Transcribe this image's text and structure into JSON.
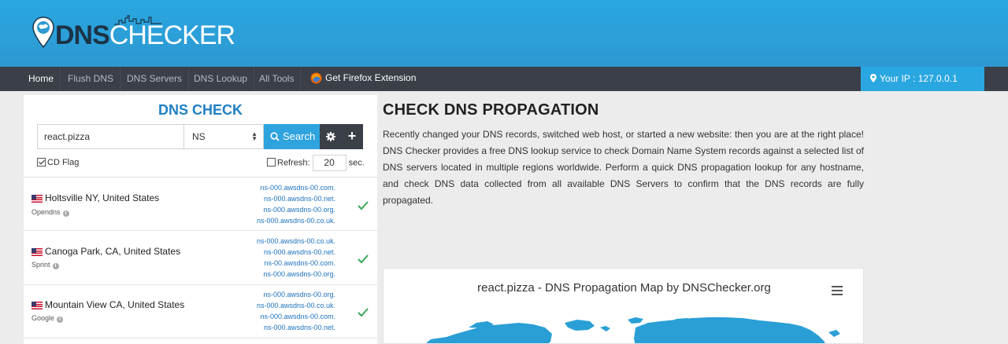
{
  "header": {
    "logo_dns": "DNS",
    "logo_checker": "CHECKER"
  },
  "nav": {
    "items": [
      {
        "label": "Home",
        "active": true
      },
      {
        "label": "Flush DNS"
      },
      {
        "label": "DNS Servers"
      },
      {
        "label": "DNS Lookup"
      },
      {
        "label": "All Tools"
      }
    ],
    "firefox_label": "Get Firefox Extension",
    "your_ip": "Your IP : 127.0.0.1"
  },
  "check": {
    "title": "DNS CHECK",
    "domain_value": "react.pizza",
    "record_type": "NS",
    "search_label": "Search",
    "cd_flag_label": "CD Flag",
    "cd_flag_checked": true,
    "refresh_label": "Refresh:",
    "refresh_value": "20",
    "refresh_unit": "sec."
  },
  "results": [
    {
      "location": "Holtsville NY, United States",
      "isp": "Opendns",
      "ns": [
        "ns-000.awsdns-00.com.",
        "ns-000.awsdns-00.net.",
        "ns-000.awsdns-00.org.",
        "ns-000.awsdns-00.co.uk."
      ],
      "status": "ok"
    },
    {
      "location": "Canoga Park, CA, United States",
      "isp": "Sprint",
      "ns": [
        "ns-000.awsdns-00.co.uk.",
        "ns-000.awsdns-00.net.",
        "ns-00.awsdns-00.com.",
        "ns-000.awsdns-00.org."
      ],
      "status": "ok"
    },
    {
      "location": "Mountain View CA, United States",
      "isp": "Google",
      "ns": [
        "ns-000.awsdns-00.org.",
        "ns-000.awsdns-00.co.uk.",
        "ns-000.awsdns-00.com.",
        "ns-000.awsdns-00.net."
      ],
      "status": "ok"
    }
  ],
  "main": {
    "title": "CHECK DNS PROPAGATION",
    "description": "Recently changed your DNS records, switched web host, or started a new website: then you are at the right place! DNS Checker provides a free DNS lookup service to check Domain Name System records against a selected list of DNS servers located in multiple regions worldwide. Perform a quick DNS propagation lookup for any hostname, and check DNS data collected from all available DNS Servers to confirm that the DNS records are fully propagated.",
    "map_title": "react.pizza - DNS Propagation Map by DNSChecker.org"
  },
  "colors": {
    "header": "#2aa7e0",
    "nav": "#3a3f48",
    "accent": "#1f7fc4",
    "ok": "#3aa757",
    "map": "#2a9fd6"
  }
}
